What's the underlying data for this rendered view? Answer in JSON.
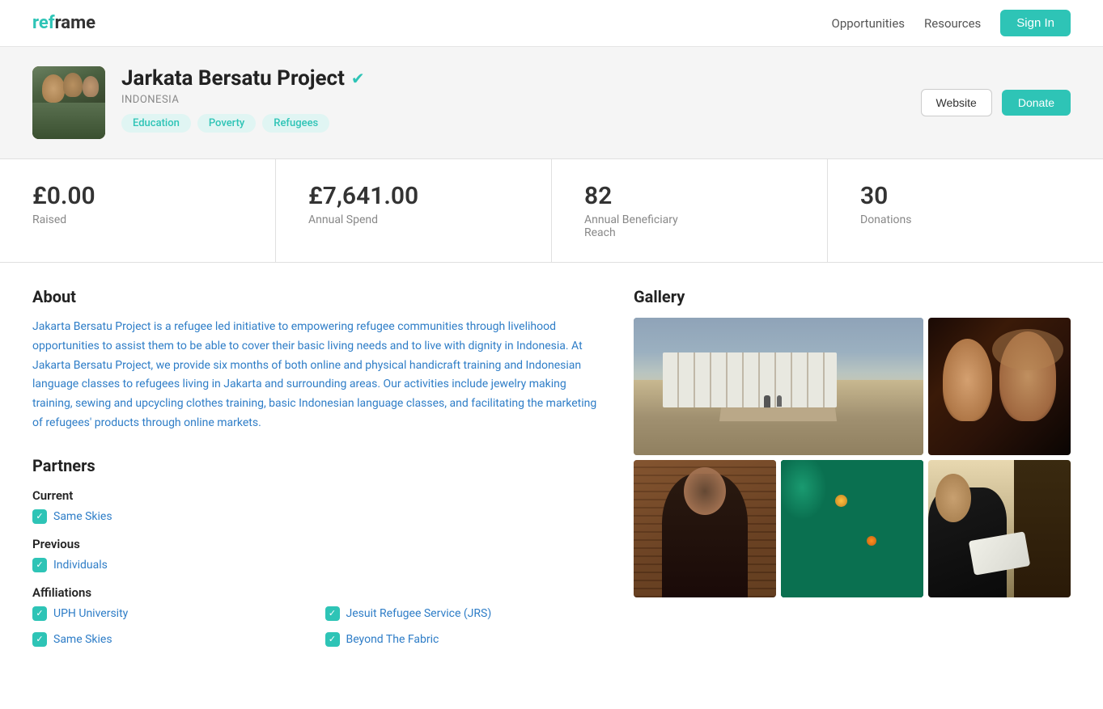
{
  "nav": {
    "logo_re": "ref",
    "logo_rest": "rame",
    "links": [
      "Opportunities",
      "Resources"
    ],
    "signin_label": "Sign In"
  },
  "profile": {
    "name": "Jarkata Bersatu Project",
    "verified": true,
    "country": "INDONESIA",
    "tags": [
      "Education",
      "Poverty",
      "Refugees"
    ],
    "website_label": "Website",
    "donate_label": "Donate"
  },
  "stats": [
    {
      "value": "£0.00",
      "label": "Raised"
    },
    {
      "value": "£7,641.00",
      "label": "Annual Spend"
    },
    {
      "value": "82",
      "label": "Annual Beneficiary\nReach"
    },
    {
      "value": "30",
      "label": "Donations"
    }
  ],
  "about": {
    "title": "About",
    "text": "Jakarta Bersatu Project is a refugee led initiative to empowering refugee communities through livelihood opportunities to assist them to be able to cover their basic living needs and to live with dignity in Indonesia. At Jakarta Bersatu Project, we provide six months of both online and physical handicraft training and Indonesian language classes to refugees living in Jakarta and surrounding areas. Our activities include jewelry making training, sewing and upcycling clothes training, basic Indonesian language classes, and facilitating the marketing of refugees' products through online markets."
  },
  "partners": {
    "title": "Partners",
    "current_label": "Current",
    "current": [
      "Same Skies"
    ],
    "previous_label": "Previous",
    "previous": [
      "Individuals"
    ],
    "affiliations_label": "Affiliations",
    "affiliations": [
      "UPH University",
      "Jesuit Refugee Service (JRS)",
      "Same Skies",
      "Beyond The Fabric"
    ]
  },
  "gallery": {
    "title": "Gallery",
    "images": [
      {
        "id": "camp",
        "alt": "Refugee camp",
        "large": true
      },
      {
        "id": "women",
        "alt": "Women portrait",
        "small_top": true
      },
      {
        "id": "woman-wall",
        "alt": "Woman by wall"
      },
      {
        "id": "bags",
        "alt": "Green bags"
      },
      {
        "id": "worker",
        "alt": "Worker"
      }
    ]
  }
}
